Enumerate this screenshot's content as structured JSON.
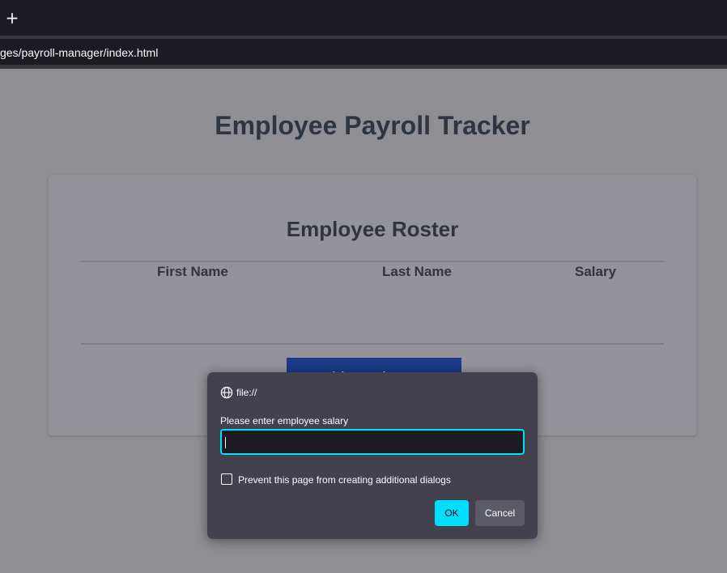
{
  "browser": {
    "new_tab_glyph": "+",
    "url": "ges/payroll-manager/index.html"
  },
  "page": {
    "title": "Employee Payroll Tracker",
    "roster_title": "Employee Roster",
    "columns": [
      "First Name",
      "Last Name",
      "Salary"
    ],
    "add_button_label": "Add Employee"
  },
  "dialog": {
    "origin": "file://",
    "prompt": "Please enter employee salary",
    "input_value": "",
    "checkbox_label": "Prevent this page from creating additional dialogs",
    "checkbox_checked": false,
    "ok_label": "OK",
    "cancel_label": "Cancel"
  },
  "colors": {
    "accent": "#00ddff",
    "dialog_bg": "#42414d",
    "add_button_bg": "#1d3a8a",
    "heading": "#2e3540"
  },
  "icons": {
    "new_tab": "plus-icon",
    "origin": "globe-icon"
  }
}
